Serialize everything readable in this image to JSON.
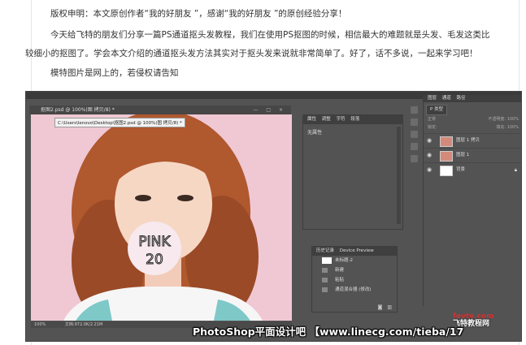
{
  "article": {
    "copyright": "版权申明：本文原创作者“我的好朋友 ”，感谢“我的好朋友 ”的原创经验分享！",
    "intro_line1": "今天给飞特的朋友们分享一篇PS通道抠头发教程，我们在使用PS抠图的时候，相信最大的难题就是头发、毛发这类比",
    "intro_line2": "较细小的抠图了。学会本文介绍的通道抠头发方法其实对于抠头发来说就非常简单了。好了，话不多说，一起来学习吧！",
    "note": "模特图片是网上的，若侵权请告知"
  },
  "photoshop": {
    "document_tab": "抠图2.psd @ 100%(图 拷贝/8) *",
    "window_controls": "— □ ×",
    "path_tooltip": "C:\\Users\\lenovo\\Desktop\\抠图2.psd @ 100%(图 拷贝/8) *",
    "image_text": "PINK 20",
    "status_zoom": "100%",
    "status_doc": "文档:972.0K/2.21M",
    "properties": {
      "tabs": [
        "属性",
        "调整",
        "字符",
        "段落"
      ],
      "content": "无属性"
    },
    "history": {
      "tabs": [
        "历史记录",
        "Device Preview"
      ],
      "items": [
        "未标题-2",
        "新建",
        "粘贴",
        "通道混合器 (修改)"
      ]
    },
    "layers": {
      "tabs": [
        "图层",
        "通道",
        "路径"
      ],
      "filter": "P 类型",
      "blend_mode": "正常",
      "opacity": "不透明度: 100%",
      "lock": "锁定:",
      "fill": "填充: 100%",
      "items": [
        {
          "name": "图层 1 拷贝",
          "thumb": "photo"
        },
        {
          "name": "图层 1",
          "thumb": "photo"
        },
        {
          "name": "背景",
          "thumb": "white"
        }
      ]
    }
  },
  "watermark": {
    "text": "PhotoShop平面设计吧 【www.linecg.com/tieba/17",
    "site_line1": "fevte.com",
    "site_line2": "飞特教程网"
  },
  "colors": {
    "ps_bg": "#535353",
    "canvas_bg": "#f0c8d4"
  }
}
